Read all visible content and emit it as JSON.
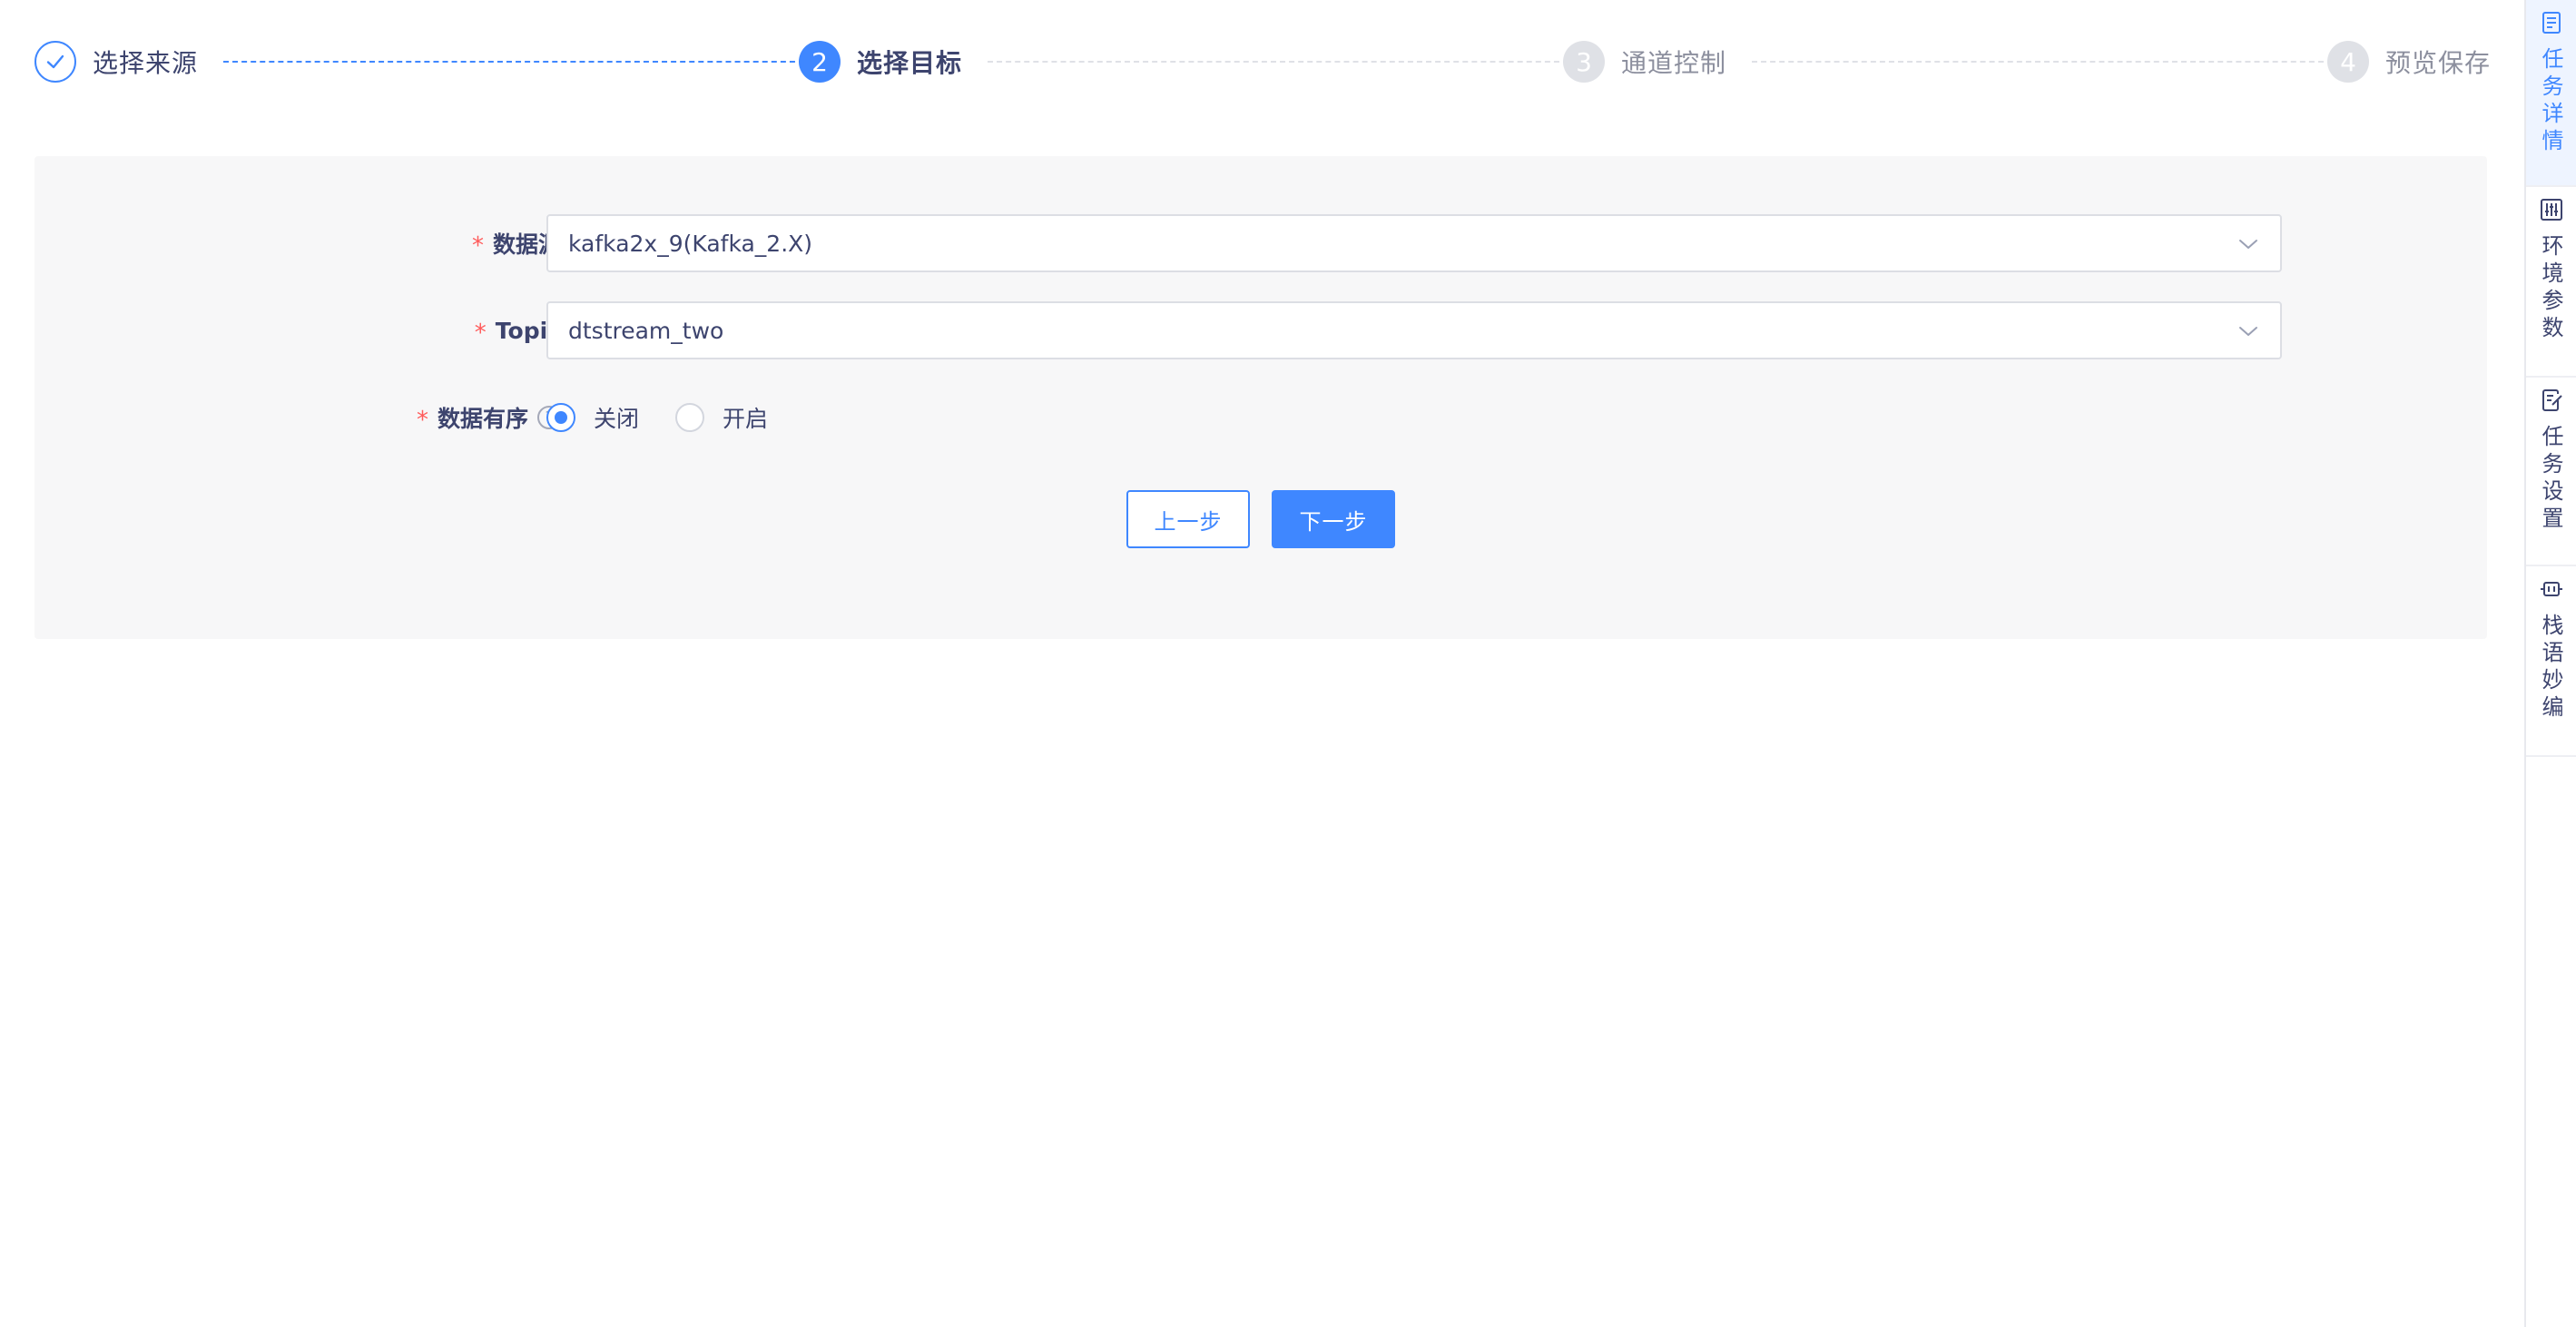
{
  "steps": [
    {
      "number": "",
      "label": "选择来源",
      "status": "finished"
    },
    {
      "number": "2",
      "label": "选择目标",
      "status": "active"
    },
    {
      "number": "3",
      "label": "通道控制",
      "status": "waiting"
    },
    {
      "number": "4",
      "label": "预览保存",
      "status": "waiting"
    }
  ],
  "form": {
    "datasource": {
      "label": "数据源",
      "value": "kafka2x_9(Kafka_2.X)"
    },
    "topic": {
      "label": "Topic",
      "value": "dtstream_two"
    },
    "ordered": {
      "label": "数据有序",
      "help": "?",
      "options": [
        {
          "label": "关闭",
          "checked": true
        },
        {
          "label": "开启",
          "checked": false
        }
      ]
    },
    "required_mark": "*"
  },
  "buttons": {
    "prev": "上一步",
    "next": "下一步"
  },
  "sidebar": {
    "items": [
      {
        "label": "任务详情",
        "icon": "document-icon",
        "active": true
      },
      {
        "label": "环境参数",
        "icon": "sliders-icon",
        "active": false
      },
      {
        "label": "任务设置",
        "icon": "edit-document-icon",
        "active": false
      },
      {
        "label": "栈语妙编",
        "icon": "code-icon",
        "active": false
      }
    ]
  },
  "colors": {
    "primary": "#3f87ff",
    "text": "#3d446e",
    "muted": "#8c8f9e",
    "panel_bg": "#f7f7f8",
    "required": "#ff5b5b"
  }
}
